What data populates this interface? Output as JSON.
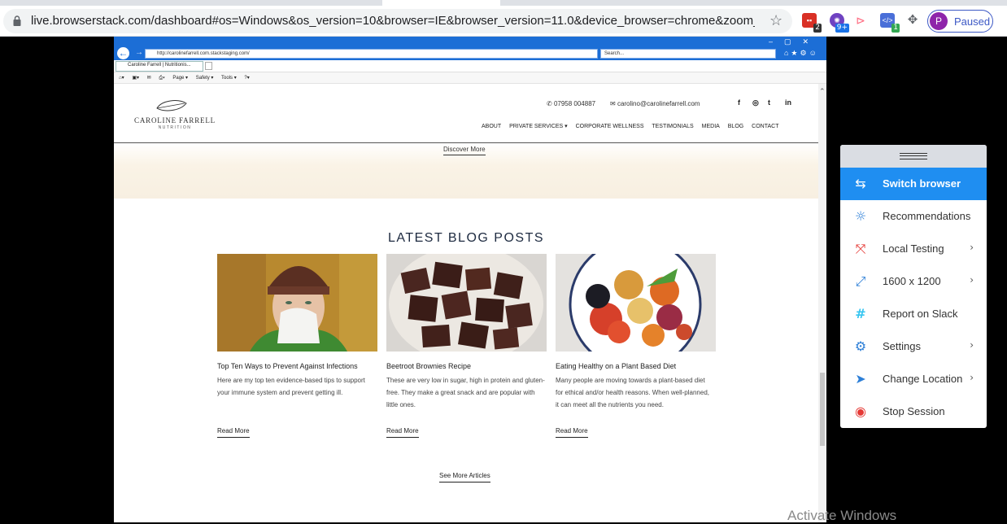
{
  "browser": {
    "url": "live.browserstack.com/dashboard#os=Windows&os_version=10&browser=IE&browser_version=11.0&device_browser=chrome&zoom_to_fit=t...",
    "profile_initial": "P",
    "profile_status": "Paused",
    "extensions": [
      {
        "name": "ext-red",
        "badge": "2",
        "color": "#d93025"
      },
      {
        "name": "ext-purple",
        "badge": "9+",
        "color": "#6f42c1"
      },
      {
        "name": "ext-pink",
        "badge": "",
        "color": "#ff6b81"
      },
      {
        "name": "ext-blue",
        "badge": "1",
        "color": "#4a6fd8"
      }
    ]
  },
  "ie": {
    "address": "http://carolinefarrell.com.stackstaging.com/",
    "search_placeholder": "Search...",
    "tab_title": "Caroline Farrell | Nutritionis...",
    "command_bar": [
      "Page ▾",
      "Safety ▾",
      "Tools ▾"
    ]
  },
  "site": {
    "logo_name": "CAROLINE FARRELL",
    "logo_sub": "NUTRITION",
    "phone": "07958 004887",
    "email": "carolino@carolinefarrell.com",
    "social": [
      "f",
      "◎",
      "t",
      "in"
    ],
    "nav": [
      "ABOUT",
      "PRIVATE SERVICES ▾",
      "CORPORATE WELLNESS",
      "TESTIMONIALS",
      "MEDIA",
      "BLOG",
      "CONTACT"
    ],
    "discover_more": "Discover More",
    "blog_heading": "LATEST BLOG POSTS",
    "posts": [
      {
        "title": "Top Ten Ways to Prevent Against Infections",
        "excerpt": "Here are my top ten evidence-based tips to support your immune system and prevent getting ill.",
        "more": "Read More"
      },
      {
        "title": "Beetroot Brownies Recipe",
        "excerpt": "These are very low in sugar, high in protein and gluten-free. They make a great snack and are popular with little ones.",
        "more": "Read More"
      },
      {
        "title": "Eating Healthy on a Plant Based Diet",
        "excerpt": "Many people are moving towards a plant-based diet for ethical and/or health reasons. When well-planned, it can meet all the nutrients you need.",
        "more": "Read More"
      }
    ],
    "see_more": "See More Articles"
  },
  "panel": {
    "items": [
      {
        "label": "Switch browser",
        "icon": "switch-icon",
        "glyph": "⇆",
        "chevron": false
      },
      {
        "label": "Recommendations",
        "icon": "bulb-icon",
        "glyph": "☼",
        "chevron": false
      },
      {
        "label": "Local Testing",
        "icon": "local-testing-icon",
        "glyph": "⤧",
        "chevron": true
      },
      {
        "label": "1600 x 1200",
        "icon": "resize-icon",
        "glyph": "⤢",
        "chevron": true
      },
      {
        "label": "Report on Slack",
        "icon": "slack-icon",
        "glyph": "#",
        "chevron": false
      },
      {
        "label": "Settings",
        "icon": "gear-icon",
        "glyph": "⚙",
        "chevron": true
      },
      {
        "label": "Change Location",
        "icon": "location-icon",
        "glyph": "➤",
        "chevron": true
      },
      {
        "label": "Stop Session",
        "icon": "stop-icon",
        "glyph": "◉",
        "chevron": false
      }
    ]
  },
  "watermark": "Activate Windows"
}
